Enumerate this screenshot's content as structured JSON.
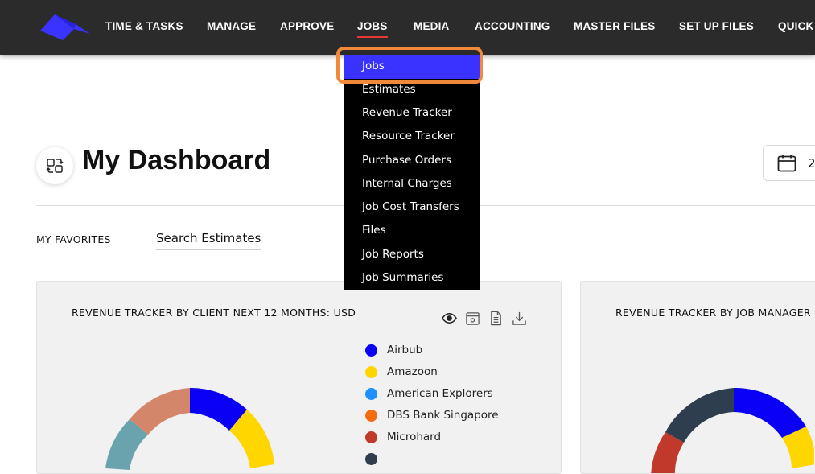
{
  "nav": {
    "items": [
      {
        "label": "TIME & TASKS"
      },
      {
        "label": "MANAGE"
      },
      {
        "label": "APPROVE"
      },
      {
        "label": "JOBS",
        "active": true
      },
      {
        "label": "MEDIA"
      },
      {
        "label": "ACCOUNTING"
      },
      {
        "label": "MASTER FILES"
      },
      {
        "label": "SET UP FILES"
      },
      {
        "label": "QUICK"
      }
    ]
  },
  "dropdown": {
    "items": [
      {
        "label": "Jobs",
        "highlighted": true
      },
      {
        "label": "Estimates"
      },
      {
        "label": "Revenue Tracker"
      },
      {
        "label": "Resource Tracker"
      },
      {
        "label": "Purchase Orders"
      },
      {
        "label": "Internal Charges"
      },
      {
        "label": "Job Cost Transfers"
      },
      {
        "label": "Files"
      },
      {
        "label": "Job Reports"
      },
      {
        "label": "Job Summaries"
      }
    ]
  },
  "dashboard": {
    "title": "My Dashboard",
    "date_text": "2",
    "favorites_label": "MY FAVORITES",
    "favorite_link": "Search Estimates"
  },
  "cards": [
    {
      "title": "REVENUE TRACKER BY CLIENT NEXT 12 MONTHS: USD",
      "tools": [
        "eye-icon",
        "preview-icon",
        "document-icon",
        "download-icon"
      ],
      "legend": [
        {
          "name": "Airbub",
          "color": "#0a00f5"
        },
        {
          "name": "Amazoon",
          "color": "#ffd600"
        },
        {
          "name": "American Explorers",
          "color": "#1e90ff"
        },
        {
          "name": "DBS Bank Singapore",
          "color": "#f36c12"
        },
        {
          "name": "Microhard",
          "color": "#c0392b"
        },
        {
          "name": "",
          "color": "#2f3e4e"
        }
      ]
    },
    {
      "title": "REVENUE TRACKER BY JOB MANAGER"
    }
  ],
  "colors": {
    "topbar": "#2b2b2b",
    "brand": "#3a33ff",
    "active_underline": "#e53935",
    "focus_ring": "#f0893b"
  }
}
